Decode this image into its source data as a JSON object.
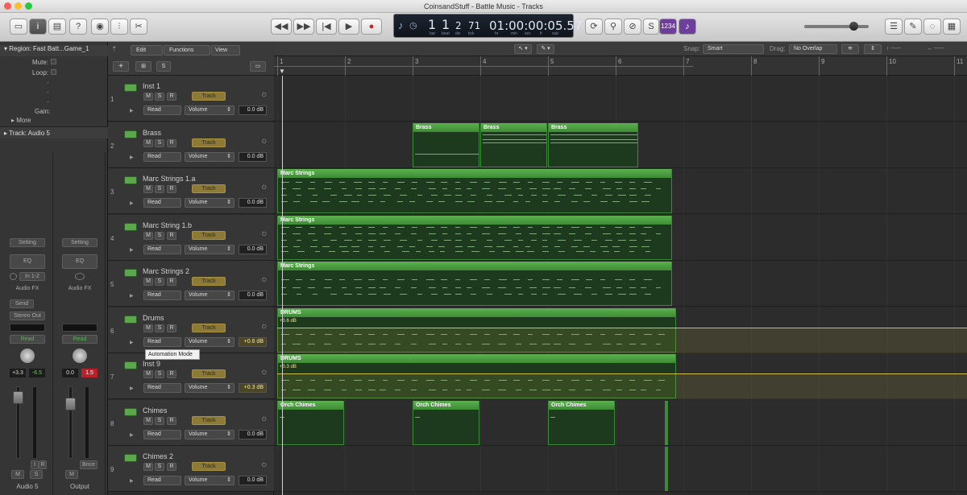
{
  "window": {
    "title": "CoinsandStuff - Battle Music - Tracks"
  },
  "transport": {
    "bar": "1",
    "beat": "1",
    "div": "2",
    "tick": "71",
    "time": "01:00:00:05.57",
    "units": [
      "bar",
      "beat",
      "div",
      "tick",
      "hr",
      "min",
      "sec",
      "fr",
      "sub"
    ],
    "count_in": "1234"
  },
  "inspector": {
    "region_header": "Region: Fast Batt...Game_1",
    "mute_label": "Mute:",
    "loop_label": "Loop:",
    "gain_label": "Gain:",
    "more_label": "More",
    "track_header": "Track:  Audio 5",
    "strips": [
      {
        "setting": "Setting",
        "eq": "EQ",
        "input": "In 1-2",
        "fx": "Audio FX",
        "send": "Send",
        "output": "Stereo Out",
        "read": "Read",
        "pan_val": "+3.3",
        "peak": "-6.5",
        "name": "Audio 5",
        "mute": "M",
        "solo": "S",
        "i": "I",
        "r": "R"
      },
      {
        "setting": "Setting",
        "eq": "EQ",
        "read": "Read",
        "pan_val": "0.0",
        "peak": "1.5",
        "name": "Output",
        "mute": "M",
        "bnce": "Bnce"
      }
    ]
  },
  "tracklist_header": {
    "edit": "Edit",
    "functions": "Functions",
    "view": "View",
    "add": "+",
    "s": "S"
  },
  "tracks": [
    {
      "num": "1",
      "name": "Inst 1",
      "mode": "Read",
      "param": "Volume",
      "value": "0.0 dB",
      "track_label": "Track"
    },
    {
      "num": "2",
      "name": "Brass",
      "mode": "Read",
      "param": "Volume",
      "value": "0.0 dB",
      "track_label": "Track"
    },
    {
      "num": "3",
      "name": "Marc Strings 1.a",
      "mode": "Read",
      "param": "Volume",
      "value": "0.0 dB",
      "track_label": "Track"
    },
    {
      "num": "4",
      "name": "Marc String 1.b",
      "mode": "Read",
      "param": "Volume",
      "value": "0.0 dB",
      "track_label": "Track"
    },
    {
      "num": "5",
      "name": "Marc Strings 2",
      "mode": "Read",
      "param": "Volume",
      "value": "0.0 dB",
      "track_label": "Track"
    },
    {
      "num": "6",
      "name": "Drums",
      "mode": "Read",
      "param": "Volume",
      "value": "+0.6 dB",
      "track_label": "Track"
    },
    {
      "num": "7",
      "name": "Inst 9",
      "mode": "Read",
      "param": "Volume",
      "value": "+0.3 dB",
      "track_label": "Track"
    },
    {
      "num": "8",
      "name": "Chimes",
      "mode": "Read",
      "param": "Volume",
      "value": "0.0 dB",
      "track_label": "Track"
    },
    {
      "num": "9",
      "name": "Chimes 2",
      "mode": "Read",
      "param": "Volume",
      "value": "0.0 dB",
      "track_label": "Track"
    }
  ],
  "tooltip": "Automation Mode",
  "arrange_toolbar": {
    "snap_label": "Snap:",
    "snap_value": "Smart",
    "drag_label": "Drag:",
    "drag_value": "No Overlap"
  },
  "ruler": [
    "1",
    "2",
    "3",
    "4",
    "5",
    "6",
    "7",
    "8",
    "9",
    "10",
    "11"
  ],
  "regions": {
    "brass": "Brass",
    "marc_strings": "Marc Strings",
    "drums": "DRUMS",
    "orch_chimes": "Orch Chimes",
    "drums_auto": "+0.6 dB",
    "inst9_auto": "+0.3 dB"
  }
}
